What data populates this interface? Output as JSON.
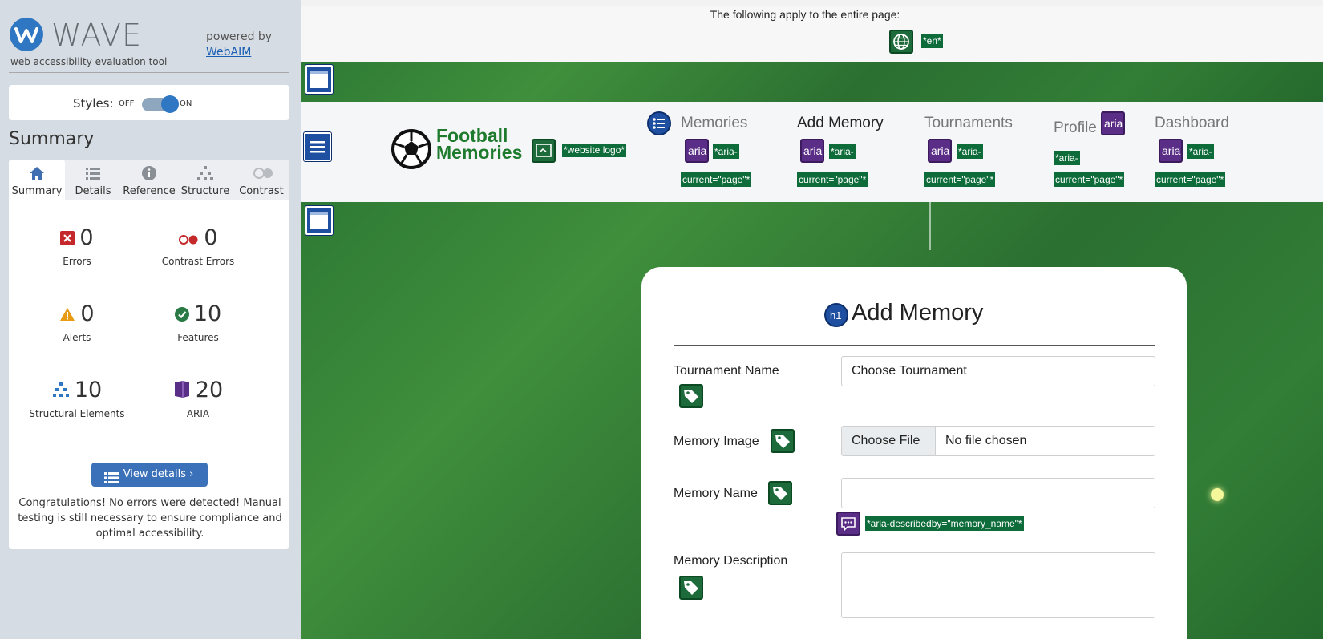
{
  "wave": {
    "logo_text": "WAVE",
    "subtitle": "web accessibility evaluation tool",
    "powered_by": "powered by",
    "webaim_link": "WebAIM",
    "styles_label": "Styles:",
    "styles_off": "OFF",
    "styles_on": "ON",
    "styles_enabled": true,
    "summary_title": "Summary",
    "tabs": [
      {
        "label": "Summary",
        "icon": "home-icon",
        "active": true
      },
      {
        "label": "Details",
        "icon": "list-icon",
        "active": false
      },
      {
        "label": "Reference",
        "icon": "info-icon",
        "active": false
      },
      {
        "label": "Structure",
        "icon": "hierarchy-icon",
        "active": false
      },
      {
        "label": "Contrast",
        "icon": "contrast-icon",
        "active": false
      }
    ],
    "stats": {
      "errors": {
        "value": "0",
        "label": "Errors"
      },
      "contrast_errors": {
        "value": "0",
        "label": "Contrast Errors"
      },
      "alerts": {
        "value": "0",
        "label": "Alerts"
      },
      "features": {
        "value": "10",
        "label": "Features"
      },
      "structural": {
        "value": "10",
        "label": "Structural Elements"
      },
      "aria": {
        "value": "20",
        "label": "ARIA"
      }
    },
    "view_details": "View details ›",
    "congrats": "Congratulations! No errors were detected! Manual testing is still necessary to ensure compliance and optimal accessibility.",
    "colors": {
      "accent": "#2f77c2",
      "error": "#c5282b",
      "alert": "#e89b12",
      "feature": "#2a7a45",
      "aria": "#5a2e87"
    }
  },
  "page": {
    "applies_text": "The following apply to the entire page:",
    "lang_label": "*en*",
    "logo_line1": "Football",
    "logo_line2": "Memories",
    "logo_alt": "*website logo*",
    "nav": [
      {
        "label": "Memories",
        "aria": "*aria-",
        "aria2": "current=\"page\"*",
        "active": false
      },
      {
        "label": "Add Memory",
        "aria": "*aria-",
        "aria2": "current=\"page\"*",
        "active": true
      },
      {
        "label": "Tournaments",
        "aria": "*aria-",
        "aria2": "current=\"page\"*",
        "active": false
      },
      {
        "label": "Profile",
        "aria": "*aria-",
        "aria2": "current=\"page\"*",
        "active": false
      },
      {
        "label": "Dashboard",
        "aria": "*aria-",
        "aria2": "current=\"page\"*",
        "active": false
      }
    ],
    "aria_badge": "aria",
    "h1_badge": "h1",
    "form_title": "Add Memory",
    "fields": {
      "tournament_label": "Tournament Name",
      "tournament_value": "Choose Tournament",
      "image_label": "Memory Image",
      "file_button": "Choose File",
      "file_status": "No file chosen",
      "name_label": "Memory Name",
      "name_value": "",
      "name_aria": "*aria-describedby=\"memory_name\"*",
      "desc_label": "Memory Description",
      "desc_value": ""
    },
    "colors": {
      "wave_green": "#0e6b3a",
      "wave_purple": "#5a2e87",
      "wave_blue": "#1e4fa0",
      "pitch": "#2e7a35"
    }
  }
}
